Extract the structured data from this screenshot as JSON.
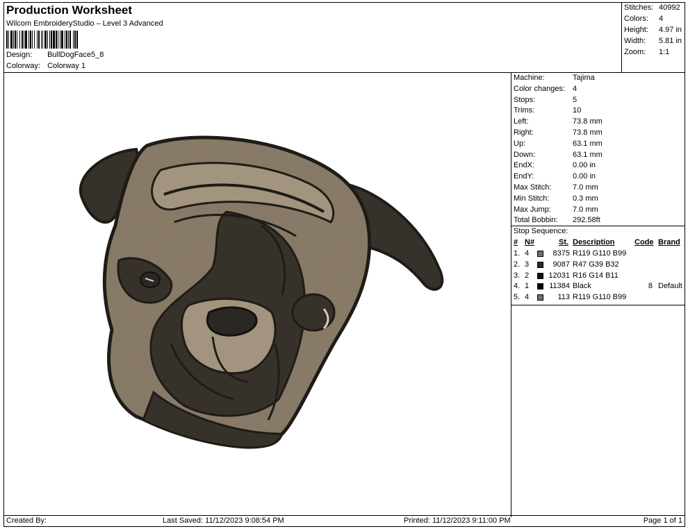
{
  "header": {
    "title": "Production Worksheet",
    "subtitle": "Wilcom EmbroideryStudio – Level 3 Advanced",
    "design_label": "Design:",
    "design_value": "BullDogFace5_8",
    "colorway_label": "Colorway:",
    "colorway_value": "Colorway 1"
  },
  "stats": {
    "stitches_label": "Stitches:",
    "stitches_value": "40992",
    "colors_label": "Colors:",
    "colors_value": "4",
    "height_label": "Height:",
    "height_value": "4.97 in",
    "width_label": "Width:",
    "width_value": "5.81 in",
    "zoom_label": "Zoom:",
    "zoom_value": "1:1"
  },
  "machine_info": [
    {
      "label": "Machine:",
      "value": "Tajima"
    },
    {
      "label": "Color changes:",
      "value": "4"
    },
    {
      "label": "Stops:",
      "value": "5"
    },
    {
      "label": "Trims:",
      "value": "10"
    },
    {
      "label": "Left:",
      "value": "73.8 mm"
    },
    {
      "label": "Right:",
      "value": "73.8 mm"
    },
    {
      "label": "Up:",
      "value": "63.1 mm"
    },
    {
      "label": "Down:",
      "value": "63.1 mm"
    },
    {
      "label": "EndX:",
      "value": "0.00 in"
    },
    {
      "label": "EndY:",
      "value": "0.00 in"
    },
    {
      "label": "Max Stitch:",
      "value": "7.0 mm"
    },
    {
      "label": "Min Stitch:",
      "value": "0.3 mm"
    },
    {
      "label": "Max Jump:",
      "value": "7.0 mm"
    },
    {
      "label": "Total Bobbin:",
      "value": "292.58ft"
    }
  ],
  "stop_sequence": {
    "title": "Stop Sequence:",
    "columns": {
      "num": "#",
      "n": "N#",
      "st": "St.",
      "desc": "Description",
      "code": "Code",
      "brand": "Brand"
    },
    "rows": [
      {
        "num": "1.",
        "n": "4",
        "color": "#776e63",
        "st": "8375",
        "desc": "R119 G110 B99",
        "code": "",
        "brand": ""
      },
      {
        "num": "2.",
        "n": "3",
        "color": "#2f2720",
        "st": "9087",
        "desc": "R47 G39 B32",
        "code": "",
        "brand": ""
      },
      {
        "num": "3.",
        "n": "2",
        "color": "#100e0b",
        "st": "12031",
        "desc": "R16 G14 B11",
        "code": "",
        "brand": ""
      },
      {
        "num": "4.",
        "n": "1",
        "color": "#000000",
        "st": "11384",
        "desc": "Black",
        "code": "8",
        "brand": "Default"
      },
      {
        "num": "5.",
        "n": "4",
        "color": "#776e63",
        "st": "113",
        "desc": "R119 G110 B99",
        "code": "",
        "brand": ""
      }
    ]
  },
  "footer": {
    "created_by": "Created By:",
    "last_saved": "Last Saved: 11/12/2023 9:08:54 PM",
    "printed": "Printed: 11/12/2023 9:11:00 PM",
    "page": "Page 1 of 1"
  },
  "design_preview": {
    "subject": "bulldog-face-embroidery",
    "colors": {
      "tan": "#8a7b68",
      "light": "#a59682",
      "dark": "#3a352d",
      "outline": "#1f1c17"
    }
  }
}
